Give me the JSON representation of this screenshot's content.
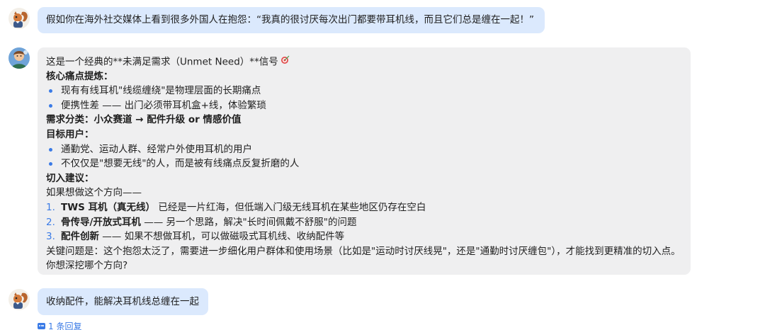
{
  "messages": {
    "user_question": "假如你在海外社交媒体上看到很多外国人在抱怨：“我真的很讨厌每次出门都要带耳机线，而且它们总是缠在一起！”",
    "bot": {
      "intro": "这是一个经典的**未满足需求（Unmet Need）**信号",
      "pain_title": "核心痛点提炼：",
      "pain_items": [
        "现有有线耳机\"线缆缠绕\"是物理层面的长期痛点",
        "便携性差 —— 出门必须带耳机盒+线，体验繁琐"
      ],
      "category": "需求分类：小众赛道 → 配件升级 or 情感价值",
      "users_title": "目标用户：",
      "user_items": [
        "通勤党、运动人群、经常户外使用耳机的用户",
        "不仅仅是\"想要无线\"的人，而是被有线痛点反复折磨的人"
      ],
      "entry_title": "切入建议：",
      "entry_lead": "如果想做这个方向——",
      "entry_items": [
        {
          "num": "1.",
          "bold": "TWS 耳机（真无线）",
          "rest": " 已经是一片红海，但低端入门级无线耳机在某些地区仍存在空白"
        },
        {
          "num": "2.",
          "bold": "骨传导/开放式耳机",
          "rest": " —— 另一个思路，解决\"长时间佩戴不舒服\"的问题"
        },
        {
          "num": "3.",
          "bold": "配件创新",
          "rest": " —— 如果不想做耳机，可以做磁吸式耳机线、收纳配件等"
        }
      ],
      "key_question": "关键问题是：这个抱怨太泛了，需要进一步细化用户群体和使用场景（比如是\"运动时讨厌线晃\"，还是\"通勤时讨厌缠包\"），才能找到更精准的切入点。",
      "followup": "你想深挖哪个方向?"
    },
    "user_reply": "收纳配件，能解决耳机线总缠在一起",
    "reply_count": "1 条回复"
  },
  "icons": {
    "user_avatar": "squirrel-avatar-icon",
    "bot_avatar": "bot-avatar-icon",
    "target": "target-icon",
    "reply": "reply-icon"
  },
  "colors": {
    "user_bubble": "#dbe9fd",
    "bot_bubble": "#efeff0",
    "accent": "#3b7be6"
  }
}
